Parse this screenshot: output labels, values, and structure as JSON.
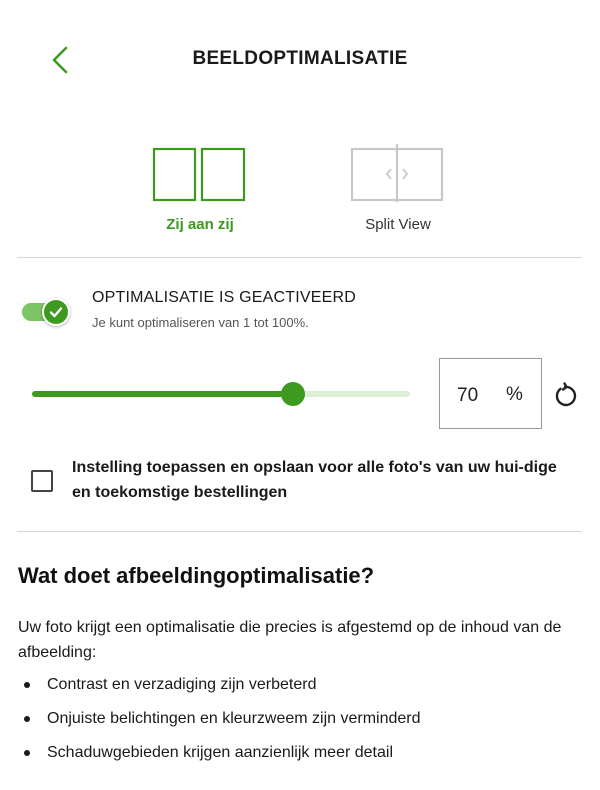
{
  "header": {
    "title": "BEELDOPTIMALISATIE",
    "back_icon": "chevron-left-icon"
  },
  "view_options": [
    {
      "label": "Zij aan zij",
      "icon": "side-by-side-icon",
      "selected": true
    },
    {
      "label": "Split View",
      "icon": "split-view-icon",
      "selected": false
    }
  ],
  "optimization": {
    "title": "OPTIMALISATIE IS GEACTIVEERD",
    "subtitle": "Je kunt optimaliseren van 1 tot 100%.",
    "toggle_on": true,
    "value": "70",
    "unit": "%",
    "slider_fraction": 0.69,
    "reset_icon": "reset-icon"
  },
  "apply_all": {
    "label": "Instelling toepassen en opslaan voor alle foto's van uw hui-dige en toekomstige bestellingen",
    "checked": false
  },
  "info": {
    "heading": "Wat doet afbeeldingoptimalisatie?",
    "intro": "Uw foto krijgt een optimalisatie die precies is afgestemd op de inhoud van de afbeelding:",
    "bullets": [
      "Contrast en verzadiging zijn verbeterd",
      "Onjuiste belichtingen en kleurzweem zijn verminderd",
      "Schaduwgebieden krijgen aanzienlijk meer detail"
    ]
  },
  "colors": {
    "accent": "#3d9a1f",
    "accent_light": "#dcefd5",
    "inactive_icon": "#c8c8c8"
  }
}
